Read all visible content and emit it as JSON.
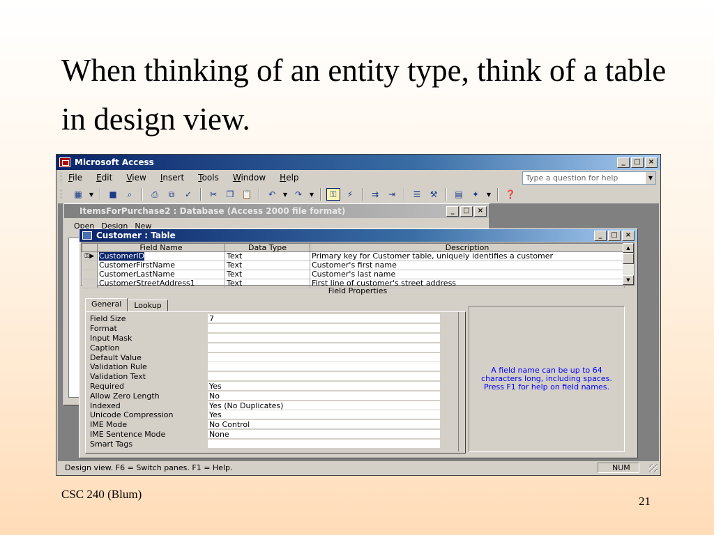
{
  "slide": {
    "title": "When thinking of an entity type, think of a table in design view.",
    "footer": "CSC 240 (Blum)",
    "page_number": "21"
  },
  "app": {
    "title": "Microsoft Access",
    "window_buttons": [
      "_",
      "□",
      "×"
    ],
    "menus": [
      "File",
      "Edit",
      "View",
      "Insert",
      "Tools",
      "Window",
      "Help"
    ],
    "help_placeholder": "Type a question for help"
  },
  "db_window": {
    "title": "ItemsForPurchase2 : Database (Access 2000 file format)",
    "tools": [
      "Open",
      "Design",
      "New"
    ]
  },
  "table_window": {
    "title": "Customer : Table",
    "columns": [
      "Field Name",
      "Data Type",
      "Description"
    ],
    "rows": [
      {
        "name": "CustomerID",
        "type": "Text",
        "desc": "Primary key for Customer table, uniquely identifies a customer"
      },
      {
        "name": "CustomerFirstName",
        "type": "Text",
        "desc": "Customer's first name"
      },
      {
        "name": "CustomerLastName",
        "type": "Text",
        "desc": "Customer's last name"
      },
      {
        "name": "CustomerStreetAddress1",
        "type": "Text",
        "desc": "First line of customer's street address"
      }
    ],
    "field_properties_label": "Field Properties",
    "tabs": [
      "General",
      "Lookup"
    ],
    "properties": [
      {
        "label": "Field Size",
        "value": "7"
      },
      {
        "label": "Format",
        "value": ""
      },
      {
        "label": "Input Mask",
        "value": ""
      },
      {
        "label": "Caption",
        "value": ""
      },
      {
        "label": "Default Value",
        "value": ""
      },
      {
        "label": "Validation Rule",
        "value": ""
      },
      {
        "label": "Validation Text",
        "value": ""
      },
      {
        "label": "Required",
        "value": "Yes"
      },
      {
        "label": "Allow Zero Length",
        "value": "No"
      },
      {
        "label": "Indexed",
        "value": "Yes (No Duplicates)"
      },
      {
        "label": "Unicode Compression",
        "value": "Yes"
      },
      {
        "label": "IME Mode",
        "value": "No Control"
      },
      {
        "label": "IME Sentence Mode",
        "value": "None"
      },
      {
        "label": "Smart Tags",
        "value": ""
      }
    ],
    "help_text": "A field name can be up to 64 characters long, including spaces.  Press F1 for help on field names."
  },
  "status": {
    "text": "Design view.  F6 = Switch panes.  F1 = Help.",
    "num": "NUM"
  }
}
